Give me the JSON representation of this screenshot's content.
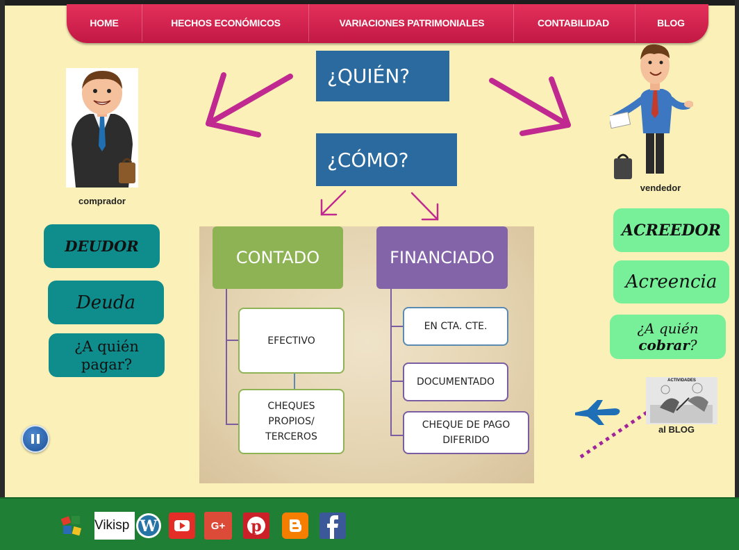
{
  "nav": {
    "items": [
      "HOME",
      "HECHOS ECONÓMICOS",
      "VARIACIONES PATRIMONIALES",
      "CONTABILIDAD",
      "BLOG"
    ]
  },
  "questions": {
    "quien": "¿QUIÉN?",
    "como": "¿CÓMO?"
  },
  "left": {
    "caption": "comprador",
    "deudor": "DEUDOR",
    "deuda": "Deuda",
    "pagar": "¿A quién pagar?"
  },
  "right": {
    "caption": "vendedor",
    "acreedor": "ACREEDOR",
    "acreencia": "Acreencia",
    "cobrar_prefix": "¿A quién",
    "cobrar_word": "cobrar",
    "cobrar_suffix": "?"
  },
  "diagram": {
    "contado": "CONTADO",
    "financiado": "FINANCIADO",
    "efectivo": "EFECTIVO",
    "cheques_line1": "CHEQUES",
    "cheques_line2": "PROPIOS/",
    "cheques_line3": "TERCEROS",
    "cta": "EN CTA. CTE.",
    "documentado": "DOCUMENTADO",
    "diferido_line1": "CHEQUE DE PAGO",
    "diferido_line2": "DIFERIDO"
  },
  "blog": {
    "thumb_label": "ACTIVIDADES",
    "caption": "al BLOG"
  },
  "footer": {
    "wiki_label": "Vikisp",
    "icons": [
      "wordpress-icon",
      "youtube-icon",
      "google-plus-icon",
      "pinterest-icon",
      "blogger-icon",
      "facebook-icon"
    ],
    "google_plus": "G+"
  },
  "colors": {
    "nav": "#d12350",
    "question": "#2b6a9e",
    "teal": "#0f8c8c",
    "mint": "#78f09a",
    "contado": "#8db354",
    "financiado": "#8464a8",
    "arrow": "#c0298f",
    "footer": "#1e7f35"
  }
}
